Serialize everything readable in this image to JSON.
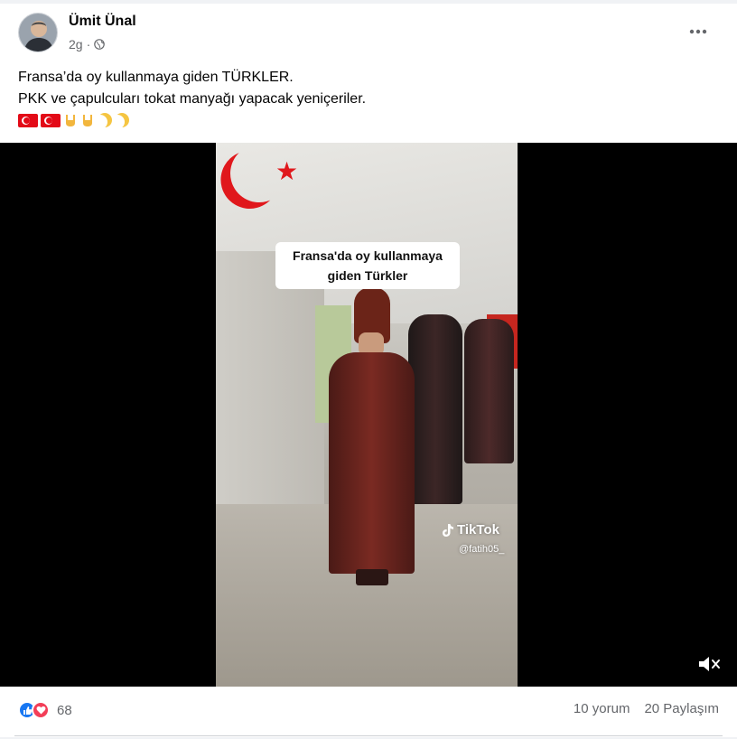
{
  "post": {
    "author": "Ümit Ünal",
    "time": "2g",
    "separator": "·",
    "privacy_icon": "globe-icon",
    "more_icon": "ellipsis-icon",
    "text_line1": "Fransa’da oy kullanmaya giden TÜRKLER.",
    "text_line2": "PKK ve çapulcuları tokat manyağı yapacak yeniçeriler.",
    "emojis": [
      "turkey-flag",
      "turkey-flag",
      "sign-of-horns",
      "sign-of-horns",
      "crescent-moon",
      "crescent-moon"
    ]
  },
  "video": {
    "caption_line1": "Fransa'da oy kullanmaya",
    "caption_line2": "giden Türkler",
    "watermark_brand": "TikTok",
    "watermark_user": "@fatih05_",
    "mute_icon": "speaker-muted-icon"
  },
  "footer": {
    "reaction_icons": [
      "like-icon",
      "love-icon"
    ],
    "reaction_count": "68",
    "comments": "10 yorum",
    "shares": "20 Paylaşım"
  },
  "colors": {
    "like": "#1877f2",
    "love": "#f33e58",
    "secondary_text": "#65676b",
    "flag_red": "#e30a17"
  }
}
